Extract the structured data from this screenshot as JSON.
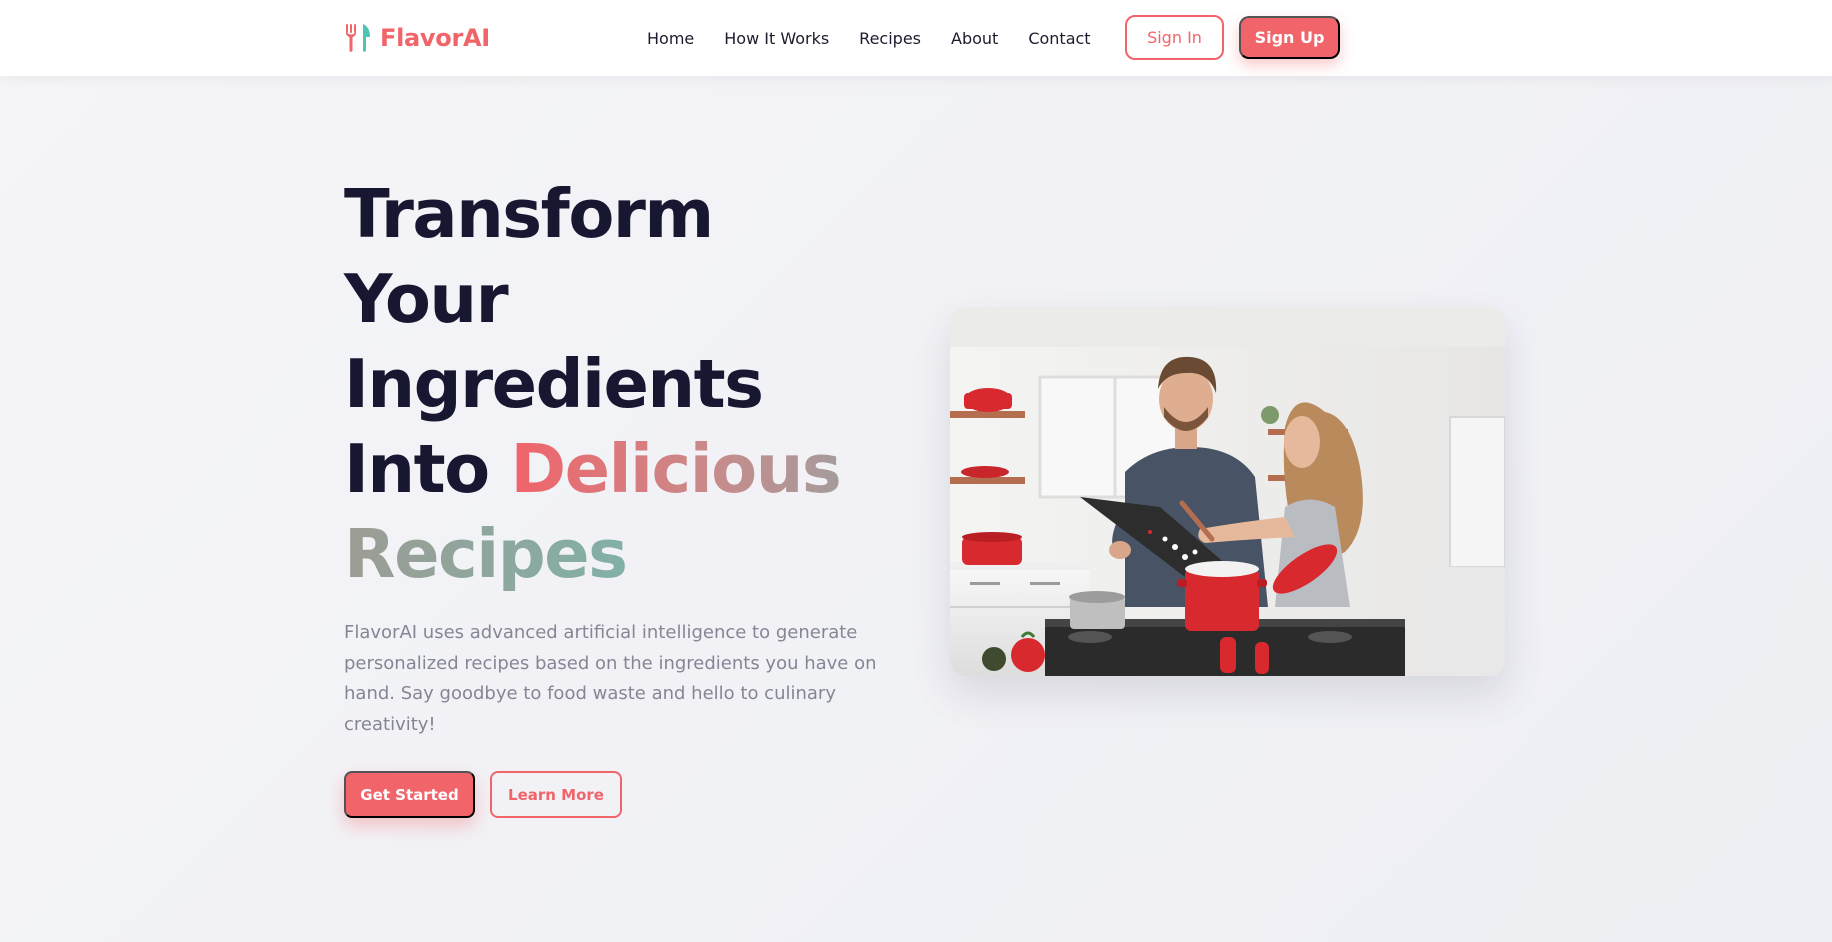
{
  "colors": {
    "brand": "#f0646a",
    "heading": "#171731",
    "body_text": "#858595",
    "teal_accent": "#4ec4b4"
  },
  "header": {
    "logo_icon": "utensils-icon",
    "brand_name": "FlavorAI",
    "nav": [
      {
        "label": "Home"
      },
      {
        "label": "How It Works"
      },
      {
        "label": "Recipes"
      },
      {
        "label": "About"
      },
      {
        "label": "Contact"
      }
    ],
    "sign_in_label": "Sign In",
    "sign_up_label": "Sign Up"
  },
  "hero": {
    "title_line1": "Transform",
    "title_line2": "Your",
    "title_line3": "Ingredients",
    "title_line4_plain": "Into ",
    "title_line4_accent": "Delicious",
    "title_line5_accent": "Recipes",
    "description": "FlavorAI uses advanced artificial intelligence to generate personalized recipes based on the ingredients you have on hand. Say goodbye to food waste and hello to culinary creativity!",
    "primary_cta": "Get Started",
    "secondary_cta": "Learn More"
  }
}
